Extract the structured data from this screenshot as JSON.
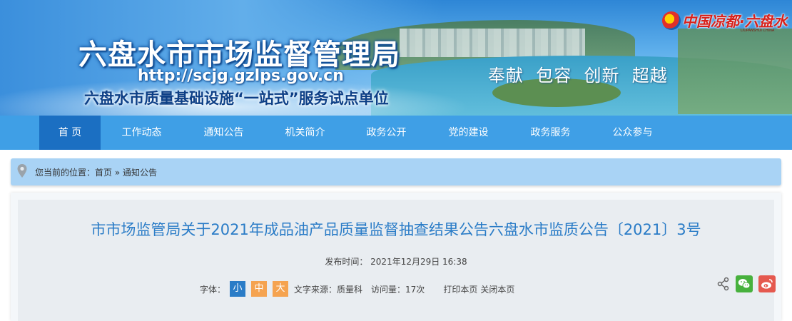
{
  "header": {
    "title": "六盘水市市场监督管理局",
    "url": "http://scjg.gzlps.gov.cn",
    "subtitle": "六盘水市质量基础设施“一站式”服务试点单位",
    "slogan": "奉献  包容  创新  超越",
    "logo_text": "中国凉都·六盘水",
    "logo_en": "LIUPANSHUI CHINA"
  },
  "nav": {
    "items": [
      "首 页",
      "工作动态",
      "通知公告",
      "机关简介",
      "政务公开",
      "党的建设",
      "政务服务",
      "公众参与"
    ],
    "active_index": 0
  },
  "breadcrumb": {
    "text": "您当前的位置：首页 » 通知公告"
  },
  "article": {
    "title": "市市场监管局关于2021年成品油产品质量监督抽查结果公告六盘水市监质公告〔2021〕3号",
    "pubdate": "发布时间： 2021年12月29日 16:38",
    "font_label": "字体：",
    "font_sizes": [
      "小",
      "中",
      "大"
    ],
    "source": "文字来源：质量科",
    "views": "访问量：17次",
    "print": "打印本页",
    "close": "关闭本页"
  },
  "share": {
    "icons": [
      "share-icon",
      "wechat-icon",
      "weibo-icon"
    ]
  },
  "colors": {
    "nav_bg": "#3f9fe6",
    "nav_active": "#1b6fc2",
    "title_blue": "#2a7cc7",
    "font_orange": "#f5a350",
    "wechat_green": "#47b13d",
    "weibo_red": "#e5594f",
    "breadcrumb_bg": "#a9d3f5"
  }
}
